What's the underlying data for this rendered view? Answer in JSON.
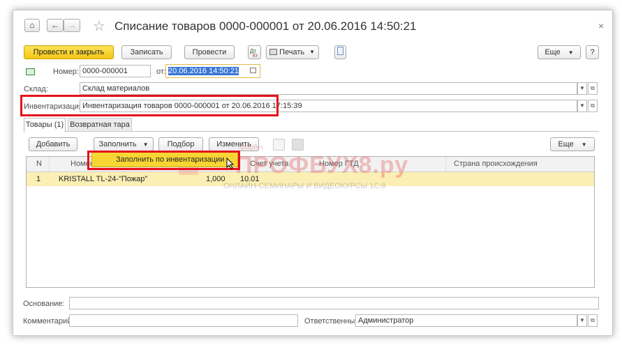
{
  "window": {
    "title": "Списание товаров 0000-000001 от 20.06.2016 14:50:21",
    "close_glyph": "×"
  },
  "nav": {
    "home_glyph": "⌂",
    "back_glyph": "←",
    "forward_glyph": "→",
    "star_glyph": "☆"
  },
  "toolbar": {
    "post_close": "Провести и закрыть",
    "save": "Записать",
    "post": "Провести",
    "print": "Печать",
    "more": "Еще",
    "help": "?"
  },
  "form": {
    "number_label": "Номер:",
    "number_value": "0000-000001",
    "date_label": "от:",
    "date_value": "20.06.2016 14:50:21",
    "warehouse_label": "Склад:",
    "warehouse_value": "Склад материалов",
    "inventory_label": "Инвентаризация:",
    "inventory_value": "Инвентаризация товаров 0000-000001 от 20.06.2016 17:15:39",
    "basis_label": "Основание:",
    "basis_value": "",
    "comment_label": "Комментарий:",
    "comment_value": "",
    "responsible_label": "Ответственный:",
    "responsible_value": "Администратор"
  },
  "tabs": [
    {
      "label": "Товары (1)"
    },
    {
      "label": "Возвратная тара"
    }
  ],
  "table_toolbar": {
    "add": "Добавить",
    "fill": "Заполнить",
    "select": "Подбор",
    "change": "Изменить",
    "more": "Еще"
  },
  "dropdown": {
    "item": "Заполнить по инвентаризации"
  },
  "table": {
    "columns": [
      "N",
      "Номенкла",
      "Счет учета",
      "Номер ГТД",
      "Страна происхождения"
    ],
    "rows": [
      {
        "n": "1",
        "item": "KRISTALL TL-24-\"Пожар\"",
        "qty": "1,000",
        "account": "10.01"
      }
    ]
  },
  "watermark": {
    "line1": "ПРОФБУХ8.ру",
    "line2": "ОНЛАЙН-СЕМИНАРЫ И ВИДЕОКУРСЫ 1С:8",
    "prefix": "профбух"
  },
  "colors": {
    "primary_button": "#f3c614",
    "highlight": "#e4101a",
    "selected_row": "#fbefb4"
  }
}
